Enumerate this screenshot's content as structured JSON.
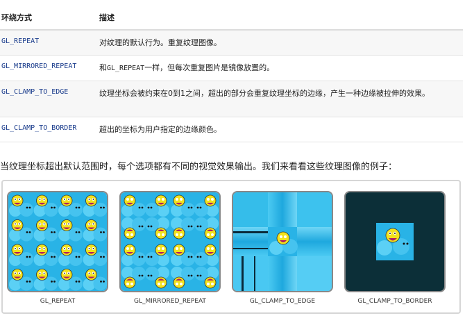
{
  "table": {
    "headers": [
      "环绕方式",
      "描述"
    ],
    "rows": [
      {
        "mode": "GL_REPEAT",
        "desc_parts": [
          "对纹理的默认行为。重复纹理图像。"
        ]
      },
      {
        "mode": "GL_MIRRORED_REPEAT",
        "desc_parts": [
          "和",
          "GL_REPEAT",
          "一样，但每次重复图片是镜像放置的。"
        ]
      },
      {
        "mode": "GL_CLAMP_TO_EDGE",
        "desc_parts": [
          "纹理坐标会被约束在0到1之间，超出的部分会重复纹理坐标的边缘，产生一种边缘被拉伸的效果。"
        ]
      },
      {
        "mode": "GL_CLAMP_TO_BORDER",
        "desc_parts": [
          "超出的坐标为用户指定的边缘颜色。"
        ]
      }
    ]
  },
  "paragraph": "当纹理坐标超出默认范围时，每个选项都有不同的视觉效果输出。我们来看看这些纹理图像的例子：",
  "figures": [
    {
      "caption": "GL_REPEAT"
    },
    {
      "caption": "GL_MIRRORED_REPEAT"
    },
    {
      "caption": "GL_CLAMP_TO_EDGE"
    },
    {
      "caption": "GL_CLAMP_TO_BORDER"
    }
  ],
  "colors": {
    "texture_blue": "#29b3e6",
    "face_yellow": "#f2e21c",
    "face_magenta": "#b0205e",
    "border_color": "#0c2f38",
    "link_blue": "#1a3c8c"
  }
}
